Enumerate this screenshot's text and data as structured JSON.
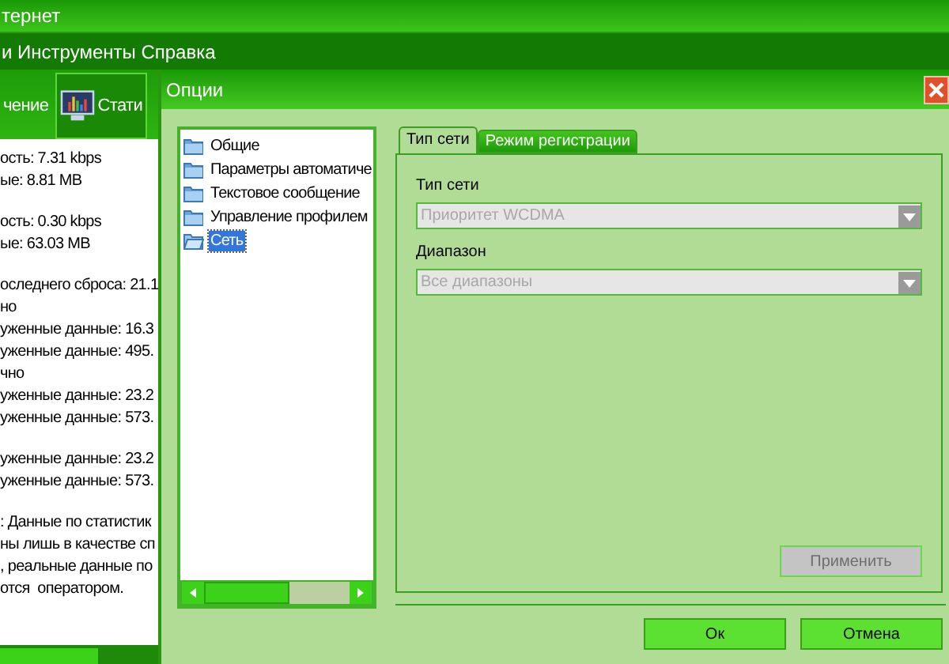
{
  "main_window": {
    "title": "тернет",
    "menu": [
      "и Инструменты Справка"
    ],
    "tabs": [
      {
        "label": "чение",
        "selected": false,
        "kind": "text"
      },
      {
        "label": "Стати",
        "selected": true,
        "kind": "icon"
      }
    ],
    "stats": [
      [
        "ость: 7.31 kbps",
        "ые: 8.81 MB"
      ],
      [
        "ость: 0.30 kbps",
        "ые: 63.03 MB"
      ],
      [
        "оследнего сброса: 21.1",
        "но",
        "уженные данные: 16.3",
        "уженные данные: 495.",
        "чно",
        "уженные данные: 23.2",
        "уженные данные: 573."
      ],
      [
        "уженные данные: 23.2",
        "уженные данные: 573."
      ],
      [
        ": Данные по статистик",
        "ны лишь в качестве сп",
        ", реальные данные по",
        "отся  оператором."
      ]
    ]
  },
  "dialog": {
    "title": "Опции",
    "tree": [
      {
        "label": "Общие",
        "selected": false
      },
      {
        "label": "Параметры автоматиче",
        "selected": false
      },
      {
        "label": "Текстовое сообщение",
        "selected": false
      },
      {
        "label": "Управление профилем",
        "selected": false
      },
      {
        "label": "Сеть",
        "selected": true
      }
    ],
    "tabs": [
      {
        "label": "Тип сети",
        "selected": true
      },
      {
        "label": "Режим регистрации",
        "selected": false
      }
    ],
    "fields": [
      {
        "label": "Тип сети",
        "value": "Приоритет WCDMA",
        "disabled": true
      },
      {
        "label": "Диапазон",
        "value": "Все диапазоны",
        "disabled": true
      }
    ],
    "apply_button": {
      "label": "Применить",
      "disabled": true
    },
    "buttons": [
      "Ок",
      "Отмена"
    ]
  }
}
